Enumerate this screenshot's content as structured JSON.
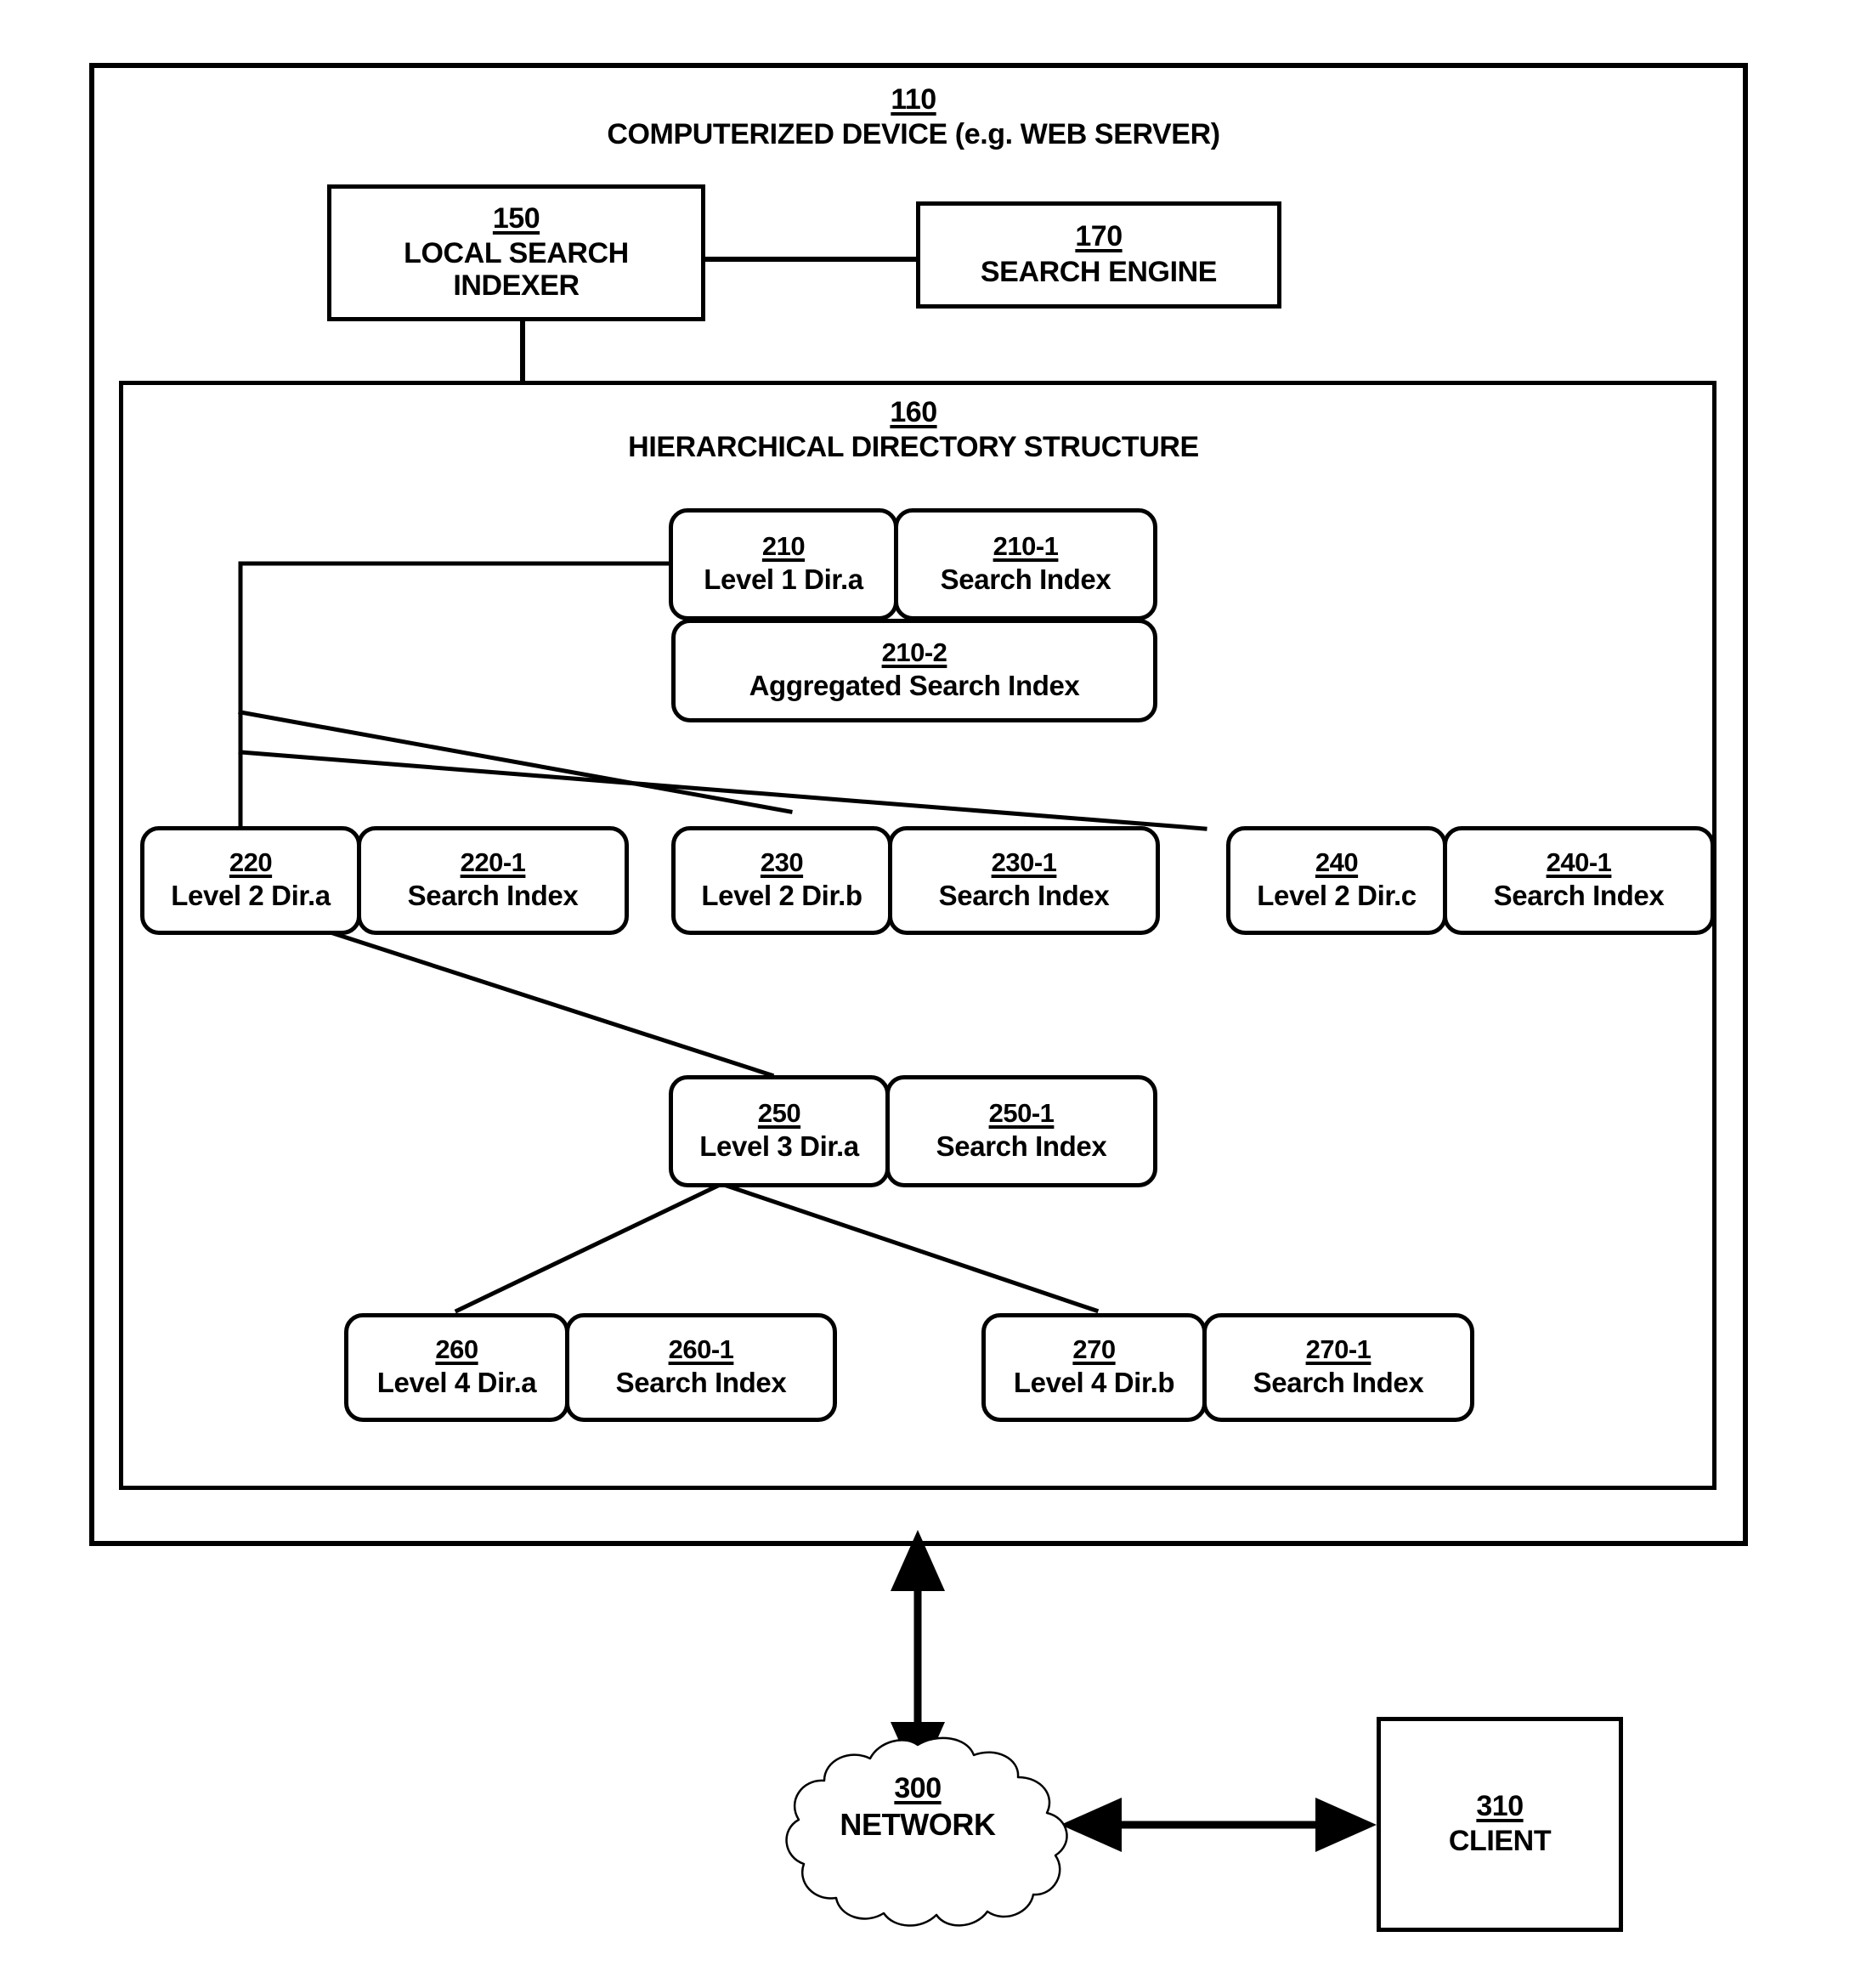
{
  "figure": {
    "device": {
      "ref": "110",
      "label": "COMPUTERIZED DEVICE (e.g. WEB SERVER)"
    },
    "indexer": {
      "ref": "150",
      "line1": "LOCAL SEARCH",
      "line2": "INDEXER"
    },
    "search_engine": {
      "ref": "170",
      "label": "SEARCH ENGINE"
    },
    "directory_structure": {
      "ref": "160",
      "label": "HIERARCHICAL DIRECTORY STRUCTURE"
    },
    "nodes": [
      {
        "ref": "210",
        "label": "Level 1 Dir.a"
      },
      {
        "ref": "210-1",
        "label": "Search Index"
      },
      {
        "ref": "210-2",
        "label": "Aggregated Search Index"
      },
      {
        "ref": "220",
        "label": "Level 2 Dir.a"
      },
      {
        "ref": "220-1",
        "label": "Search Index"
      },
      {
        "ref": "230",
        "label": "Level 2 Dir.b"
      },
      {
        "ref": "230-1",
        "label": "Search Index"
      },
      {
        "ref": "240",
        "label": "Level 2 Dir.c"
      },
      {
        "ref": "240-1",
        "label": "Search Index"
      },
      {
        "ref": "250",
        "label": "Level 3 Dir.a"
      },
      {
        "ref": "250-1",
        "label": "Search Index"
      },
      {
        "ref": "260",
        "label": "Level 4 Dir.a"
      },
      {
        "ref": "260-1",
        "label": "Search Index"
      },
      {
        "ref": "270",
        "label": "Level 4 Dir.b"
      },
      {
        "ref": "270-1",
        "label": "Search Index"
      }
    ],
    "network": {
      "ref": "300",
      "label": "NETWORK"
    },
    "client": {
      "ref": "310",
      "label": "CLIENT"
    }
  }
}
